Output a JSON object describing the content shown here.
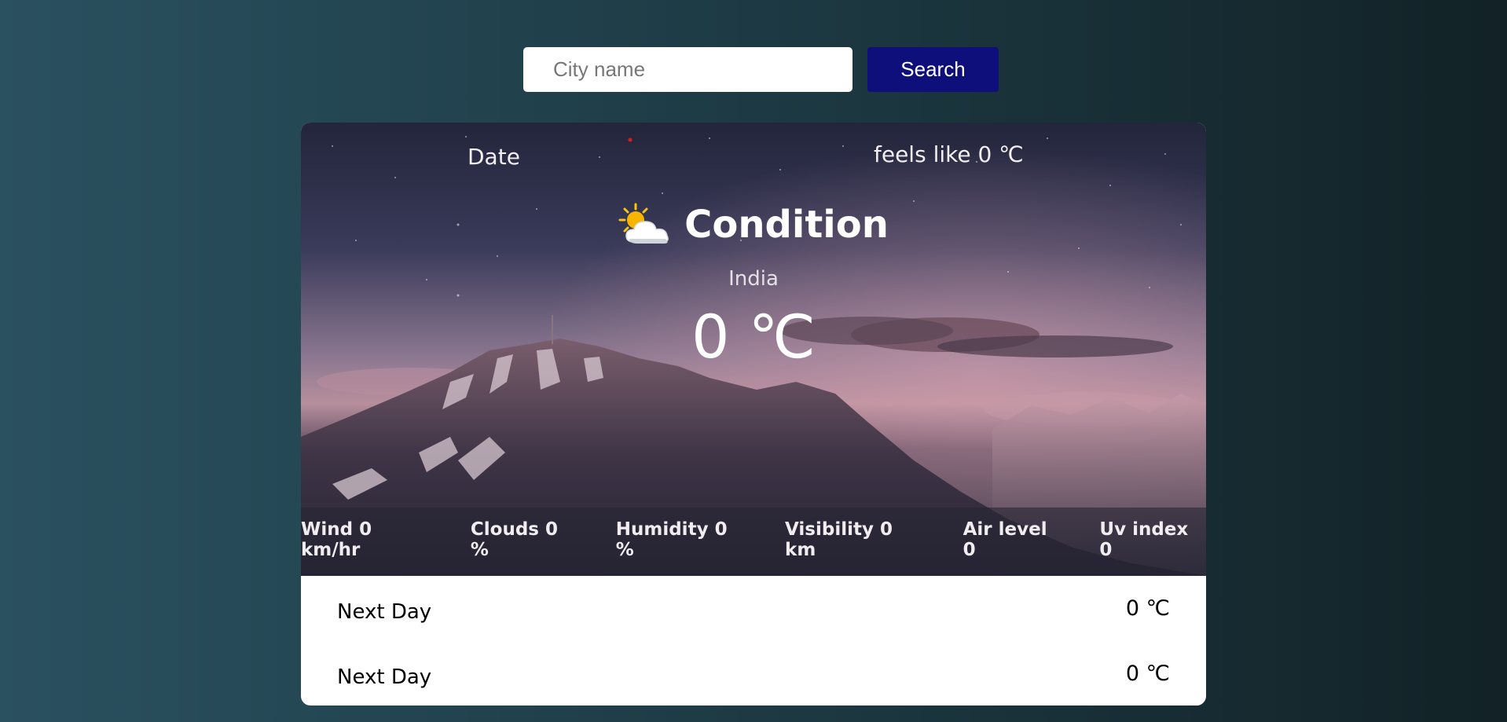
{
  "search": {
    "placeholder": "City name",
    "button_label": "Search"
  },
  "weather": {
    "date_label": "Date",
    "feels_like": "feels like 0 ℃",
    "condition": "Condition",
    "condition_icon": "partly-cloudy-icon",
    "location": "India",
    "temperature": "0 ℃"
  },
  "stats": [
    {
      "label": "Wind 0 km/hr"
    },
    {
      "label": "Clouds 0 %"
    },
    {
      "label": "Humidity 0 %"
    },
    {
      "label": "Visibility 0 km"
    },
    {
      "label": "Air level 0"
    },
    {
      "label": "Uv index 0"
    }
  ],
  "forecast": [
    {
      "day": "Next Day",
      "temp": "0 ℃"
    },
    {
      "day": "Next Day",
      "temp": "0 ℃"
    }
  ],
  "colors": {
    "search_button": "#0e0f7a",
    "background_start": "#2a5160",
    "background_end": "#122226"
  }
}
